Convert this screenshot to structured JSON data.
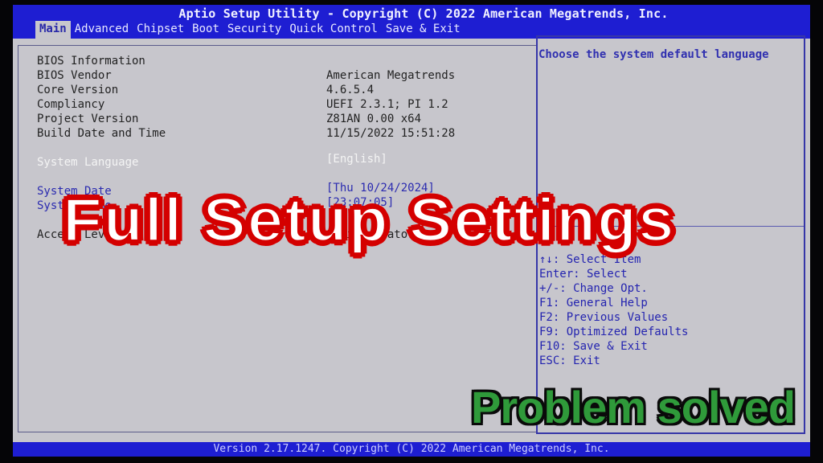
{
  "header": {
    "title": "Aptio Setup Utility - Copyright (C) 2022 American Megatrends, Inc."
  },
  "tabs": [
    {
      "label": "Main",
      "active": true
    },
    {
      "label": "Advanced",
      "active": false
    },
    {
      "label": "Chipset",
      "active": false
    },
    {
      "label": "Boot",
      "active": false
    },
    {
      "label": "Security",
      "active": false
    },
    {
      "label": "Quick Control",
      "active": false
    },
    {
      "label": "Save & Exit",
      "active": false
    }
  ],
  "main": {
    "bios_information_label": "BIOS Information",
    "info_rows": [
      {
        "label": "BIOS Vendor",
        "value": "American Megatrends"
      },
      {
        "label": "Core Version",
        "value": "4.6.5.4"
      },
      {
        "label": "Compliancy",
        "value": "UEFI 2.3.1; PI 1.2"
      },
      {
        "label": "Project Version",
        "value": "Z81AN 0.00 x64"
      },
      {
        "label": "Build Date and Time",
        "value": "11/15/2022 15:51:28"
      }
    ],
    "system_language": {
      "label": "System Language",
      "value": "[English]"
    },
    "system_date": {
      "label": "System Date",
      "value": "[Thu 10/24/2024]"
    },
    "system_time": {
      "label": "System Time",
      "value": "[23:07:05]"
    },
    "access_level": {
      "label": "Access Level",
      "value": "Administrator"
    }
  },
  "help": {
    "description": "Choose the system default language",
    "keys": [
      "↑↓: Select Item",
      "Enter: Select",
      "+/-: Change Opt.",
      "F1: General Help",
      "F2: Previous Values",
      "F9: Optimized Defaults",
      "F10: Save & Exit",
      "ESC: Exit"
    ]
  },
  "footer": {
    "version_text": "Version 2.17.1247. Copyright (C) 2022 American Megatrends, Inc."
  },
  "overlays": {
    "headline": "Full Setup Settings",
    "tagline": "Problem solved",
    "headline_fill": "#ffffff",
    "headline_outline": "#d40000",
    "tagline_fill": "#2f9a3a"
  },
  "colors": {
    "bar_blue": "#1e1ed2",
    "panel_gray": "#c7c6cc",
    "help_text_blue": "#3030b0"
  }
}
